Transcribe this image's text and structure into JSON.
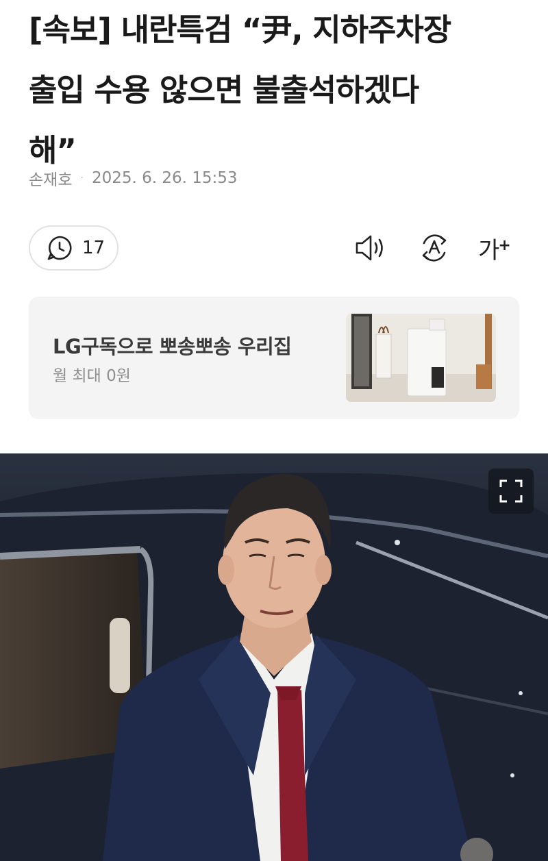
{
  "article": {
    "headline_line1": "[속보] 내란특검 “尹, 지하주차장",
    "headline_line2": "출입 수용 않으면 불출석하겠다",
    "headline_line3": "해”",
    "author": "손재호",
    "separator": "·",
    "published": "2025. 6. 26. 15:53"
  },
  "toolbar": {
    "comment_count": "17",
    "icons": [
      "comment-icon",
      "speaker-icon",
      "translate-icon",
      "font-size-icon"
    ],
    "font_size_label": "가",
    "font_size_plus": "+"
  },
  "ad": {
    "title": "LG구독으로 뽀송뽀송 우리집",
    "subtitle": "월 최대 0원"
  },
  "photo": {
    "icons": [
      "expand-icon"
    ]
  }
}
